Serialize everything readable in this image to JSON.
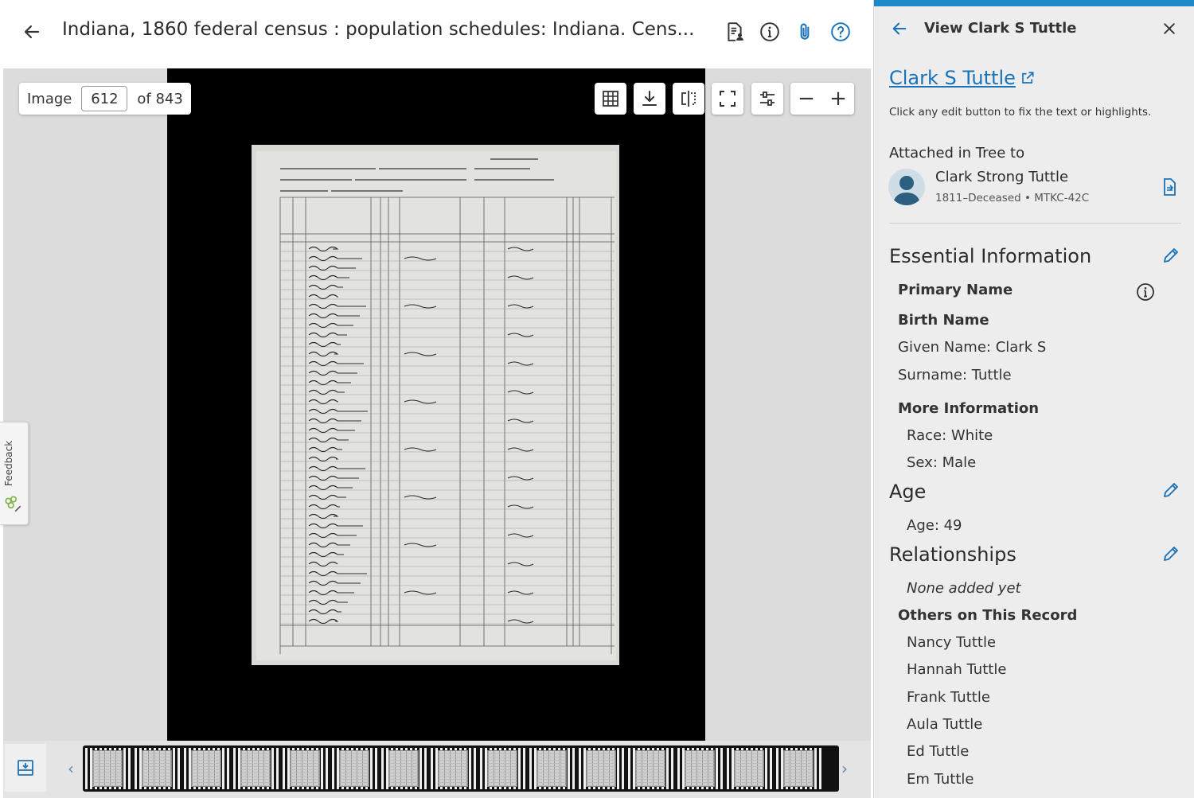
{
  "viewer": {
    "title": "Indiana, 1860 federal census : population schedules: Indiana. Cens...",
    "image_label": "Image",
    "image_number": "612",
    "image_total": "of 843",
    "zoom_out": "−",
    "zoom_in": "+",
    "feedback_label": "Feedback"
  },
  "panel": {
    "header": "View Clark S Tuttle",
    "person_link": "Clark S Tuttle",
    "edit_hint": "Click any edit button to fix the text or highlights.",
    "attached_label": "Attached in Tree to",
    "tree_person_name": "Clark Strong Tuttle",
    "tree_person_meta": "1811–Deceased • MTKC-42C",
    "essential": {
      "title": "Essential Information",
      "primary_name": "Primary Name",
      "birth_name": "Birth Name",
      "given_name": "Given Name: Clark S",
      "surname": "Surname: Tuttle",
      "more_info": "More Information",
      "race": "Race: White",
      "sex": "Sex: Male"
    },
    "age": {
      "title": "Age",
      "value": "Age: 49"
    },
    "relationships": {
      "title": "Relationships",
      "none": "None added yet",
      "others_title": "Others on This Record",
      "others": [
        "Nancy Tuttle",
        "Hannah Tuttle",
        "Frank Tuttle",
        "Aula Tuttle",
        "Ed Tuttle",
        "Em Tuttle"
      ]
    }
  },
  "colors": {
    "accent": "#1e88c7",
    "link": "#1a73b8",
    "panel_bg": "#ededed",
    "viewer_bg": "#dcdcdc"
  },
  "icons": [
    "arrow-left-icon",
    "document-person-icon",
    "info-icon",
    "paperclip-icon",
    "help-icon",
    "grid-icon",
    "download-icon",
    "compare-icon",
    "fullscreen-icon",
    "adjust-icon",
    "close-icon",
    "external-link-icon",
    "pencil-icon",
    "tree-record-icon"
  ]
}
